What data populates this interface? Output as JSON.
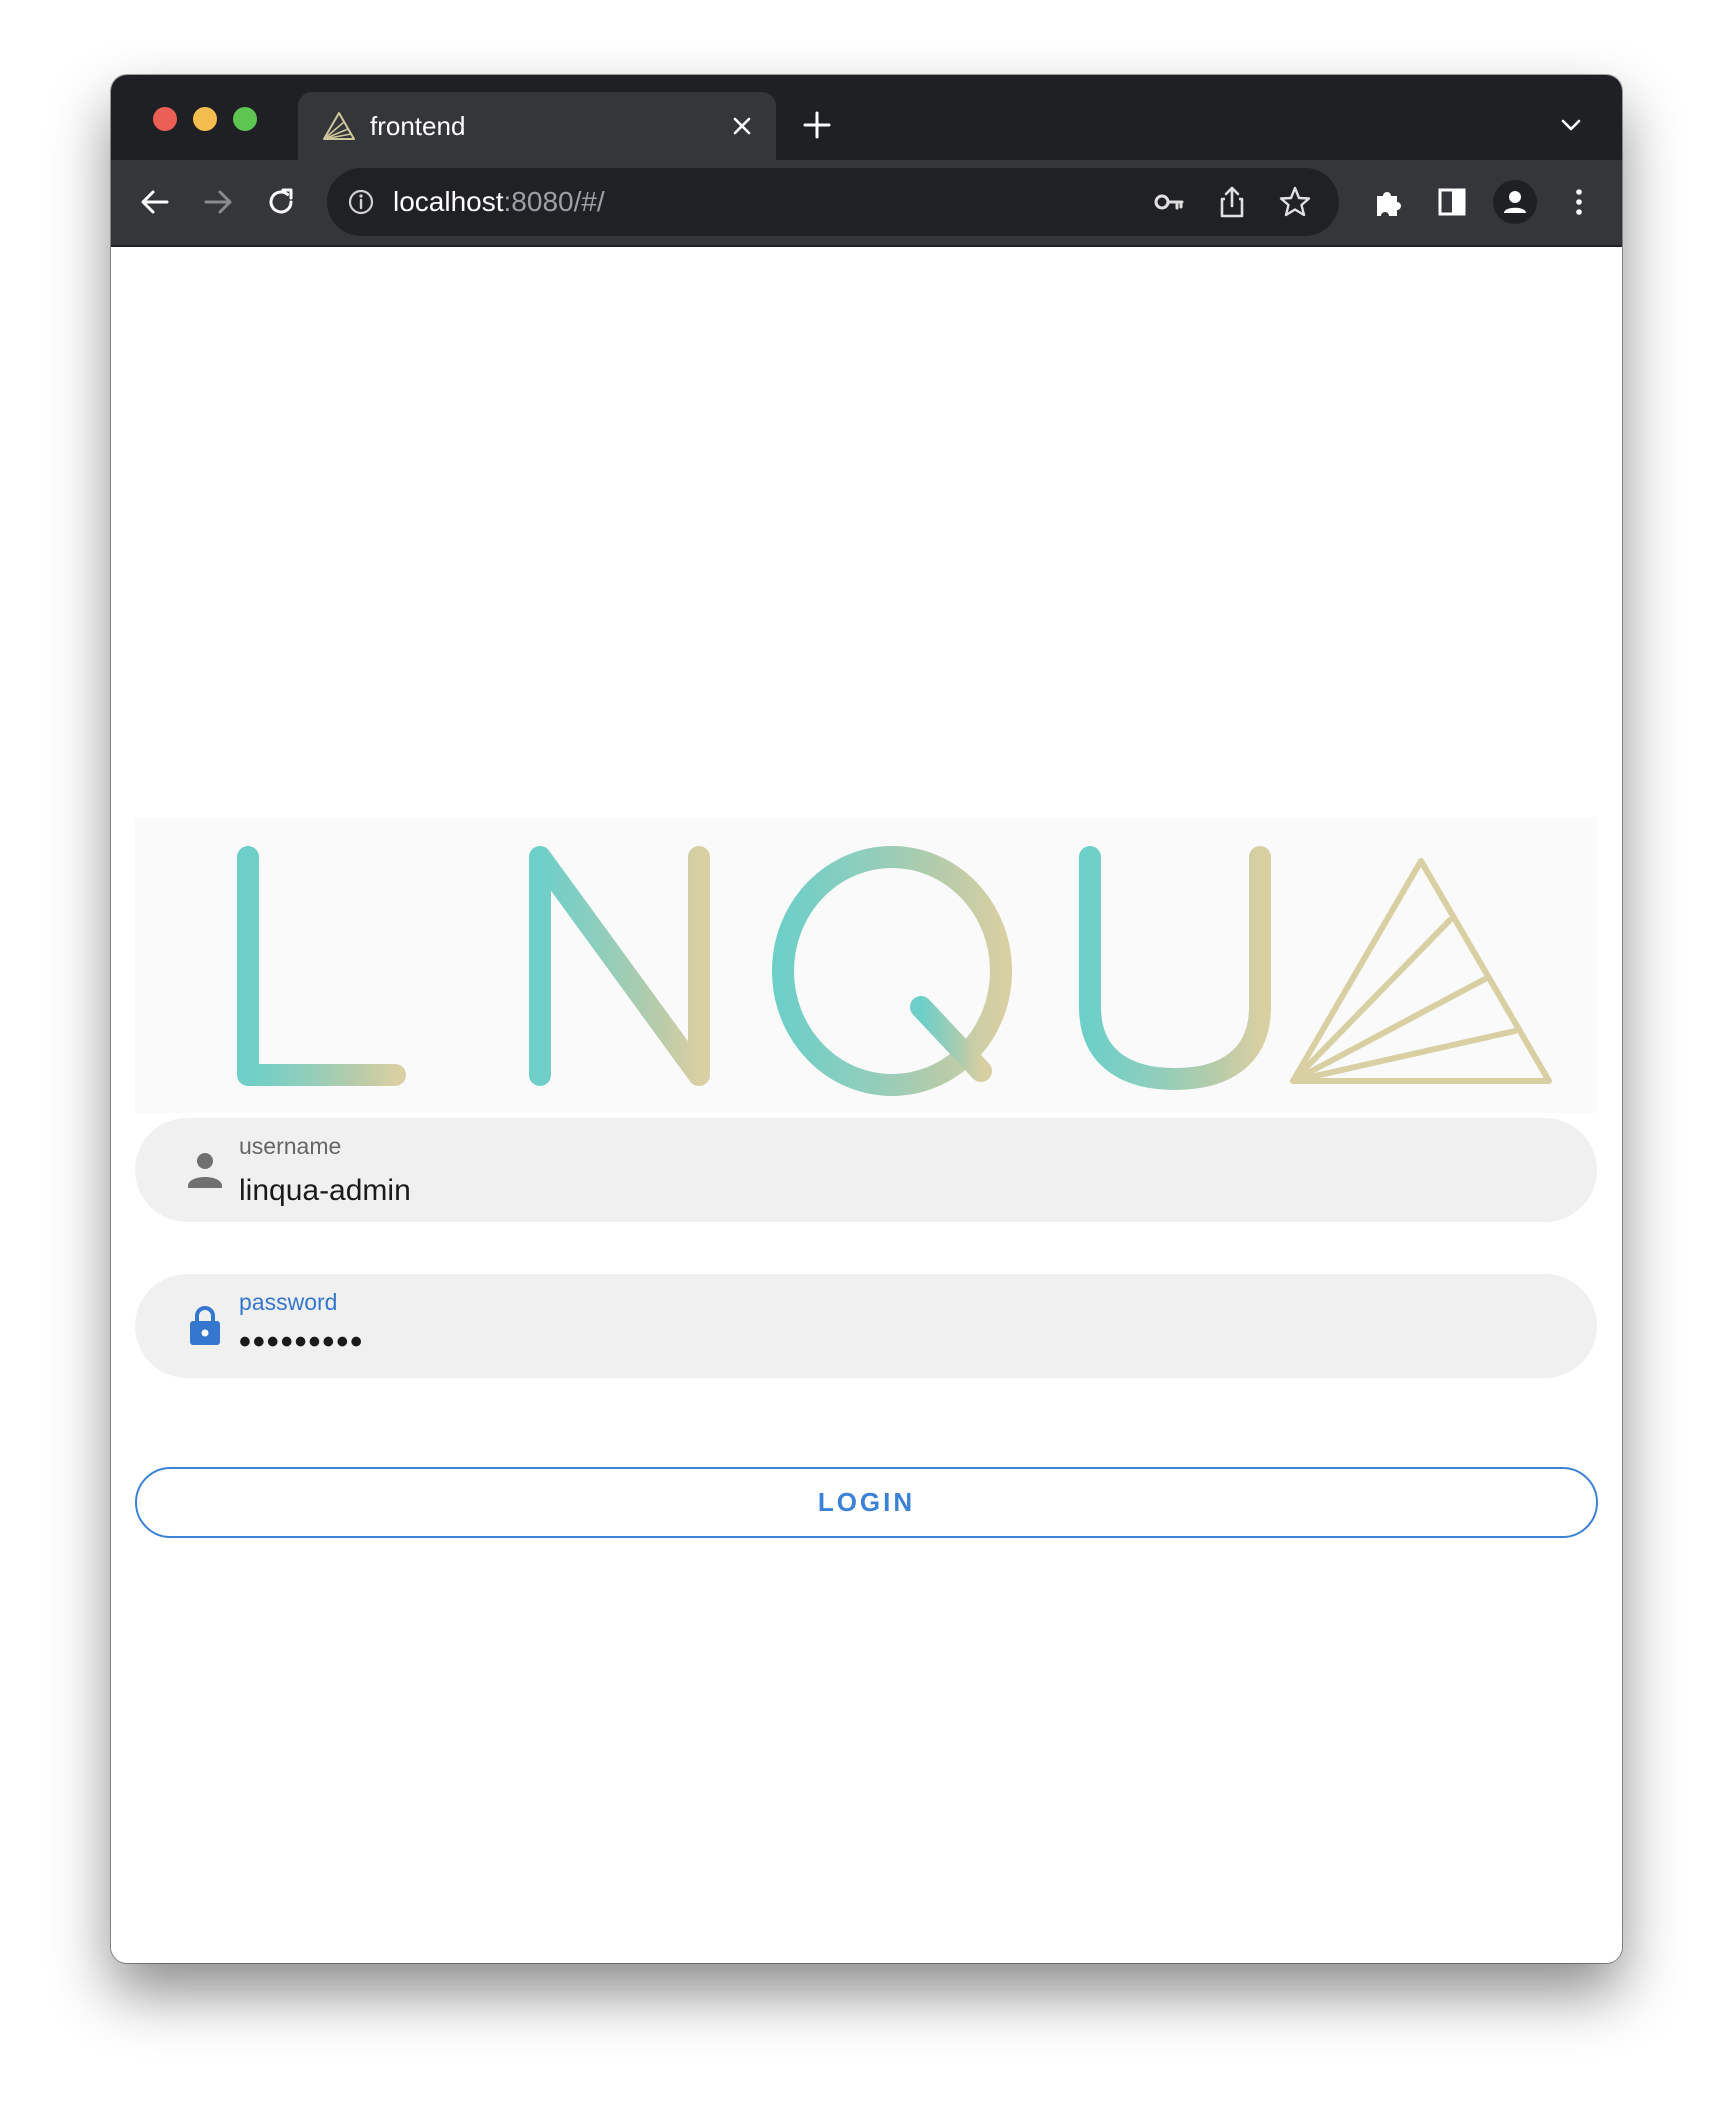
{
  "browser": {
    "tab_title": "frontend",
    "url_host": "localhost",
    "url_rest": ":8080/#/"
  },
  "icons": {
    "back": "arrow-left-icon",
    "forward": "arrow-right-icon",
    "reload": "reload-icon",
    "info": "info-icon",
    "key": "key-icon",
    "share": "share-icon",
    "star": "star-icon",
    "extensions": "puzzle-icon",
    "side_panel": "side-panel-icon",
    "profile": "profile-icon",
    "menu": "kebab-menu-icon",
    "user": "person-icon",
    "lock": "lock-icon"
  },
  "logo": {
    "text": "LINQUA",
    "colors": [
      "#6fcfc6",
      "#b9cba9",
      "#d6cfa4"
    ]
  },
  "login_form": {
    "username": {
      "label": "username",
      "value": "linqua-admin"
    },
    "password": {
      "label": "password",
      "value": "•••••••••"
    },
    "login_button": "LOGIN"
  },
  "colors": {
    "accent": "#3b82d6",
    "field_bg": "#f0f0f0",
    "chrome_dark": "#1f2023",
    "chrome_toolbar": "#35363a"
  }
}
